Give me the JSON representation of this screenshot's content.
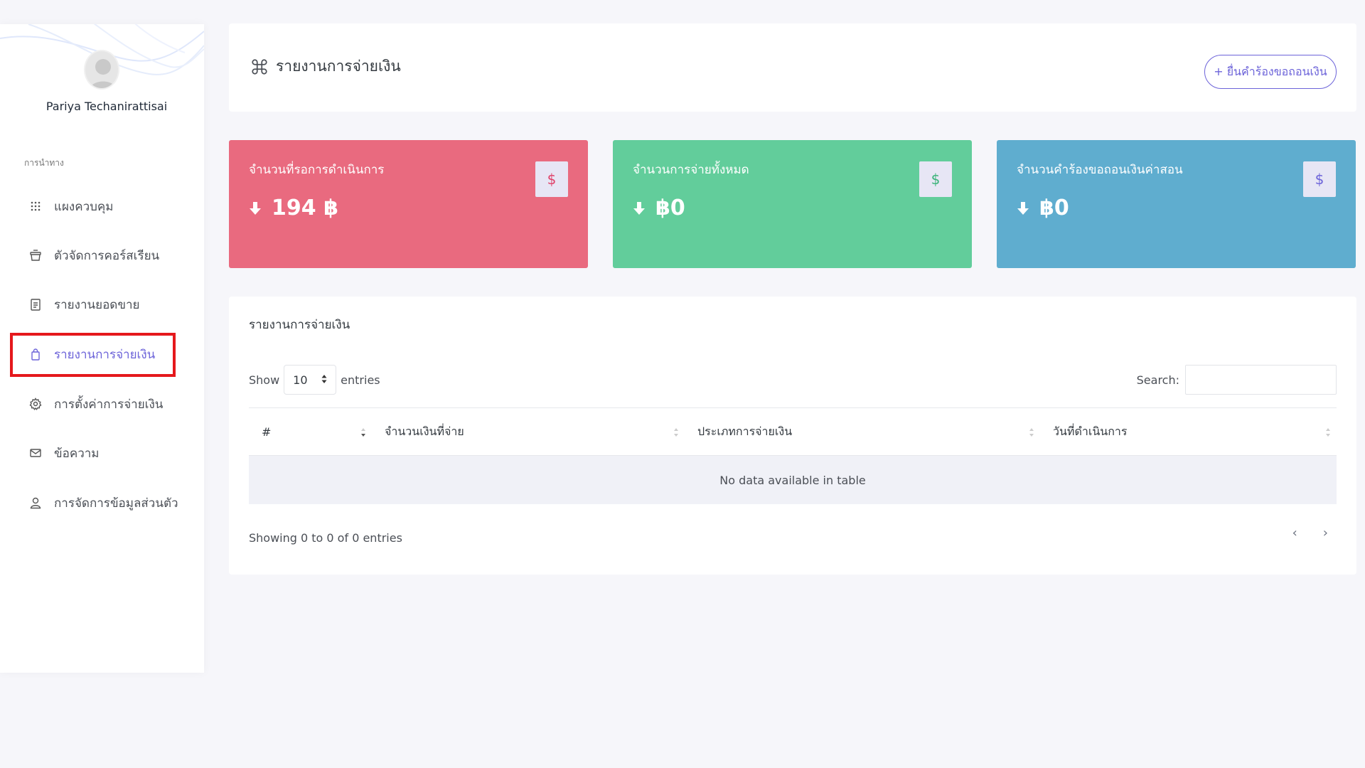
{
  "user": {
    "name": "Pariya Techanirattisai"
  },
  "sidebar": {
    "caption": "การนำทาง",
    "items": [
      {
        "label": "แผงควบคุม",
        "icon": "grid-icon"
      },
      {
        "label": "ตัวจัดการคอร์สเรียน",
        "icon": "basket-icon"
      },
      {
        "label": "รายงานยอดขาย",
        "icon": "clipboard-icon"
      },
      {
        "label": "รายงานการจ่ายเงิน",
        "icon": "bag-icon",
        "active": true
      },
      {
        "label": "การตั้งค่าการจ่ายเงิน",
        "icon": "gear-icon"
      },
      {
        "label": "ข้อความ",
        "icon": "mail-icon"
      },
      {
        "label": "การจัดการข้อมูลส่วนตัว",
        "icon": "user-icon"
      }
    ]
  },
  "header": {
    "title": "รายงานการจ่ายเงิน",
    "add_button": "+ ยื่นคำร้องขอถอนเงิน"
  },
  "stats": [
    {
      "label": "จำนวนที่รอการดำเนินการ",
      "value": "194 ฿",
      "color": "#e96a7f",
      "badge_color": "#e0426a"
    },
    {
      "label": "จำนวนการจ่ายทั้งหมด",
      "value": "฿0",
      "color": "#62cd9b",
      "badge_color": "#3bb37a"
    },
    {
      "label": "จำนวนคำร้องขอถอนเงินค่าสอน",
      "value": "฿0",
      "color": "#5fadcf",
      "badge_color": "#6c63d9"
    }
  ],
  "table": {
    "title": "รายงานการจ่ายเงิน",
    "show_label": "Show",
    "entries_value": "10",
    "entries_label": "entries",
    "search_label": "Search:",
    "columns": [
      "#",
      "จำนวนเงินที่จ่าย",
      "ประเภทการจ่ายเงิน",
      "วันที่ดำเนินการ"
    ],
    "empty_text": "No data available in table",
    "info": "Showing 0 to 0 of 0 entries",
    "prev": "‹",
    "next": "›"
  },
  "accent": "#6c63d9"
}
